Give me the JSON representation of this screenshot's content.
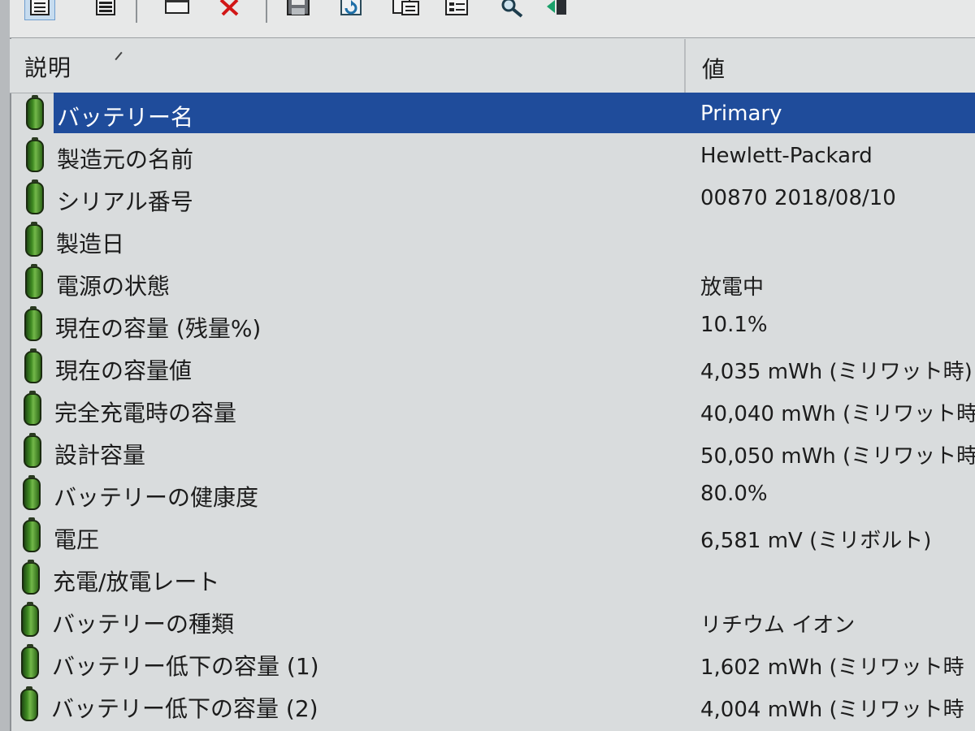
{
  "toolbar": {
    "buttons": [
      {
        "icon": "report-view-icon",
        "pressed": true
      },
      {
        "icon": "list-view-icon",
        "pressed": false
      },
      {
        "icon": "window-icon",
        "pressed": false
      },
      {
        "icon": "delete-icon",
        "pressed": false
      },
      {
        "icon": "save-icon",
        "pressed": false
      },
      {
        "icon": "refresh-icon",
        "pressed": false
      },
      {
        "icon": "copy-icon",
        "pressed": false
      },
      {
        "icon": "properties-icon",
        "pressed": false
      },
      {
        "icon": "search-icon",
        "pressed": false
      },
      {
        "icon": "exit-icon",
        "pressed": false
      }
    ]
  },
  "columns": {
    "description": "説明",
    "value": "値"
  },
  "rows": [
    {
      "description": "バッテリー名",
      "value": "Primary",
      "selected": true
    },
    {
      "description": "製造元の名前",
      "value": "Hewlett-Packard",
      "selected": false
    },
    {
      "description": "シリアル番号",
      "value": "00870 2018/08/10",
      "selected": false
    },
    {
      "description": "製造日",
      "value": "",
      "selected": false
    },
    {
      "description": "電源の状態",
      "value": "放電中",
      "selected": false
    },
    {
      "description": "現在の容量 (残量%)",
      "value": "10.1%",
      "selected": false
    },
    {
      "description": "現在の容量値",
      "value": "4,035 mWh (ミリワット時)",
      "selected": false
    },
    {
      "description": "完全充電時の容量",
      "value": "40,040 mWh (ミリワット時",
      "selected": false
    },
    {
      "description": "設計容量",
      "value": "50,050 mWh (ミリワット時",
      "selected": false
    },
    {
      "description": "バッテリーの健康度",
      "value": "80.0%",
      "selected": false
    },
    {
      "description": "電圧",
      "value": "6,581 mV (ミリボルト)",
      "selected": false
    },
    {
      "description": "充電/放電レート",
      "value": "",
      "selected": false
    },
    {
      "description": "バッテリーの種類",
      "value": "リチウム イオン",
      "selected": false
    },
    {
      "description": "バッテリー低下の容量 (1)",
      "value": "1,602 mWh (ミリワット時",
      "selected": false
    },
    {
      "description": "バッテリー低下の容量 (2)",
      "value": "4,004 mWh (ミリワット時",
      "selected": false
    }
  ],
  "colors": {
    "selection": "#1f4c9b",
    "battery_icon": "#3f8a22",
    "background": "#d9dcdd"
  }
}
